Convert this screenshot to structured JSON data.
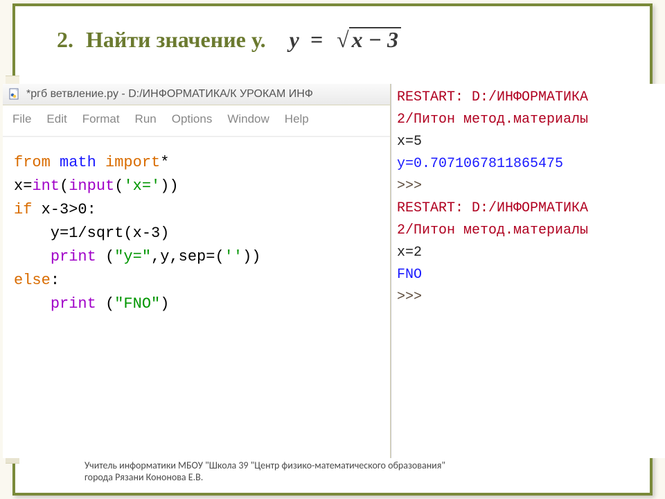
{
  "heading": {
    "number": "2.",
    "text": "Найти значение у.",
    "formula_lhs": "y",
    "formula_eq": "=",
    "formula_under_sqrt": "x − 3"
  },
  "editor": {
    "title": "*ргб ветвление.py - D:/ИНФОРМАТИКА/К УРОКАМ ИНФ",
    "menu": [
      "File",
      "Edit",
      "Format",
      "Run",
      "Options",
      "Window",
      "Help"
    ],
    "code": {
      "l1_from": "from",
      "l1_math": "math",
      "l1_import": "import",
      "l1_star": "*",
      "l2_pre": "x=",
      "l2_int": "int",
      "l2_mid": "(",
      "l2_input": "input",
      "l2_open": "(",
      "l2_str": "'x='",
      "l2_close": "))",
      "l3_if": "if",
      "l3_cond": " x-3>0:",
      "l4_indent": "    y=1/sqrt(x-3)",
      "l5_indent": "    ",
      "l5_print": "print",
      "l5_args_open": " (",
      "l5_str1": "\"y=\"",
      "l5_mid": ",y,sep=(",
      "l5_str2": "''",
      "l5_close": "))",
      "l6_else": "else",
      "l6_colon": ":",
      "l7_indent": "    ",
      "l7_print": "print",
      "l7_open": " (",
      "l7_str": "\"FNO\"",
      "l7_close": ")"
    }
  },
  "shell": {
    "line1a": " RESTART: D:/ИНФОРМАТИКА",
    "line1b": "2/Питон метод.материалы",
    "line2": "x=5",
    "line3": "y=0.7071067811865475",
    "prompt1": ">>>",
    "line5a": " RESTART: D:/ИНФОРМАТИКА",
    "line5b": "2/Питон метод.материалы",
    "line6": "x=2",
    "line7": "FNO",
    "prompt2": ">>>"
  },
  "footer": {
    "line1": "Учитель информатики МБОУ \"Школа 39 \"Центр физико-математического образования\"",
    "line2": "города Рязани Кононова Е.В."
  }
}
